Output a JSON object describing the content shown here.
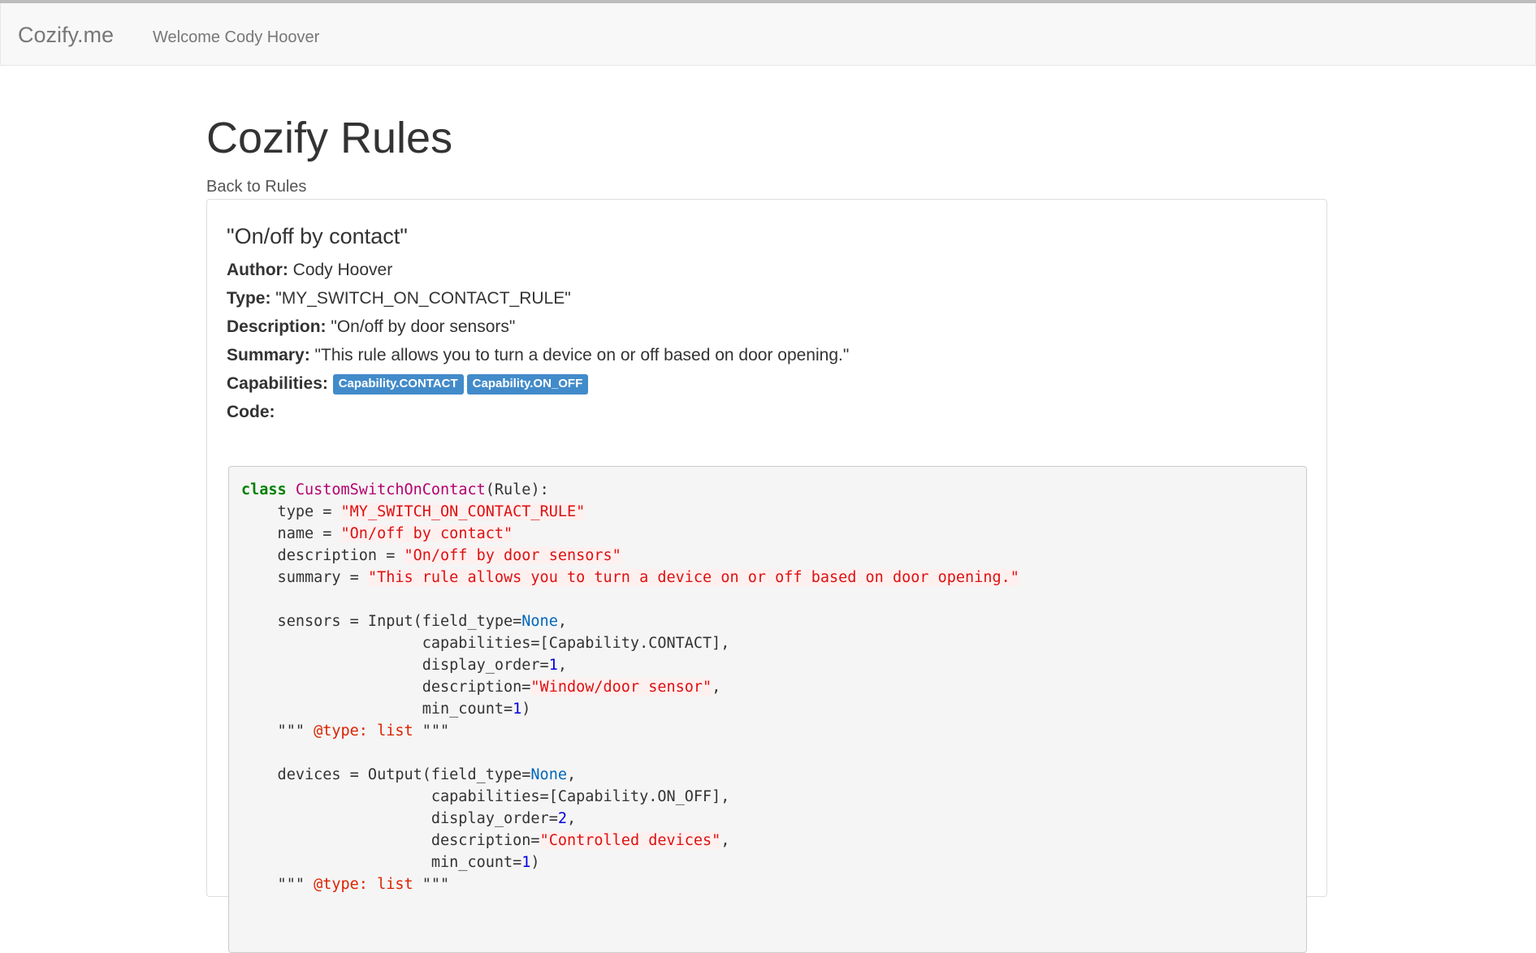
{
  "navbar": {
    "brand": "Cozify.me",
    "welcome": "Welcome Cody Hoover"
  },
  "page": {
    "title": "Cozify Rules",
    "back_link": "Back to Rules"
  },
  "rule": {
    "name": "\"On/off by contact\"",
    "author_label": "Author:",
    "author": "Cody Hoover",
    "type_label": "Type:",
    "type": "\"MY_SWITCH_ON_CONTACT_RULE\"",
    "description_label": "Description:",
    "description": "\"On/off by door sensors\"",
    "summary_label": "Summary:",
    "summary": "\"This rule allows you to turn a device on or off based on door opening.\"",
    "capabilities_label": "Capabilities:",
    "capabilities": [
      "Capability.CONTACT",
      "Capability.ON_OFF"
    ],
    "code_label": "Code:"
  },
  "code_lines": [
    [
      {
        "t": "class",
        "c": "kw"
      },
      {
        "t": " "
      },
      {
        "t": "CustomSwitchOnContact",
        "c": "cls"
      },
      {
        "t": "(Rule):"
      }
    ],
    [
      {
        "t": "    type = "
      },
      {
        "t": "\"MY_SWITCH_ON_CONTACT_RULE\"",
        "c": "str"
      }
    ],
    [
      {
        "t": "    name = "
      },
      {
        "t": "\"On/off by contact\"",
        "c": "str"
      }
    ],
    [
      {
        "t": "    description = "
      },
      {
        "t": "\"On/off by door sensors\"",
        "c": "str"
      }
    ],
    [
      {
        "t": "    summary = "
      },
      {
        "t": "\"This rule allows you to turn a device on or off based on door opening.\"",
        "c": "str"
      }
    ],
    [
      {
        "t": ""
      }
    ],
    [
      {
        "t": "    sensors = Input(field_type="
      },
      {
        "t": "None",
        "c": "none"
      },
      {
        "t": ","
      }
    ],
    [
      {
        "t": "                    capabilities=[Capability.CONTACT],"
      }
    ],
    [
      {
        "t": "                    display_order="
      },
      {
        "t": "1",
        "c": "num"
      },
      {
        "t": ","
      }
    ],
    [
      {
        "t": "                    description="
      },
      {
        "t": "\"Window/door sensor\"",
        "c": "str"
      },
      {
        "t": ","
      }
    ],
    [
      {
        "t": "                    min_count="
      },
      {
        "t": "1",
        "c": "num"
      },
      {
        "t": ")"
      }
    ],
    [
      {
        "t": "    \"\"\" "
      },
      {
        "t": "@type: list",
        "c": "doc"
      },
      {
        "t": " \"\"\""
      }
    ],
    [
      {
        "t": ""
      }
    ],
    [
      {
        "t": "    devices = Output(field_type="
      },
      {
        "t": "None",
        "c": "none"
      },
      {
        "t": ","
      }
    ],
    [
      {
        "t": "                     capabilities=[Capability.ON_OFF],"
      }
    ],
    [
      {
        "t": "                     display_order="
      },
      {
        "t": "2",
        "c": "num"
      },
      {
        "t": ","
      }
    ],
    [
      {
        "t": "                     description="
      },
      {
        "t": "\"Controlled devices\"",
        "c": "str"
      },
      {
        "t": ","
      }
    ],
    [
      {
        "t": "                     min_count="
      },
      {
        "t": "1",
        "c": "num"
      },
      {
        "t": ")"
      }
    ],
    [
      {
        "t": "    \"\"\" "
      },
      {
        "t": "@type: list",
        "c": "doc"
      },
      {
        "t": " \"\"\""
      }
    ]
  ]
}
